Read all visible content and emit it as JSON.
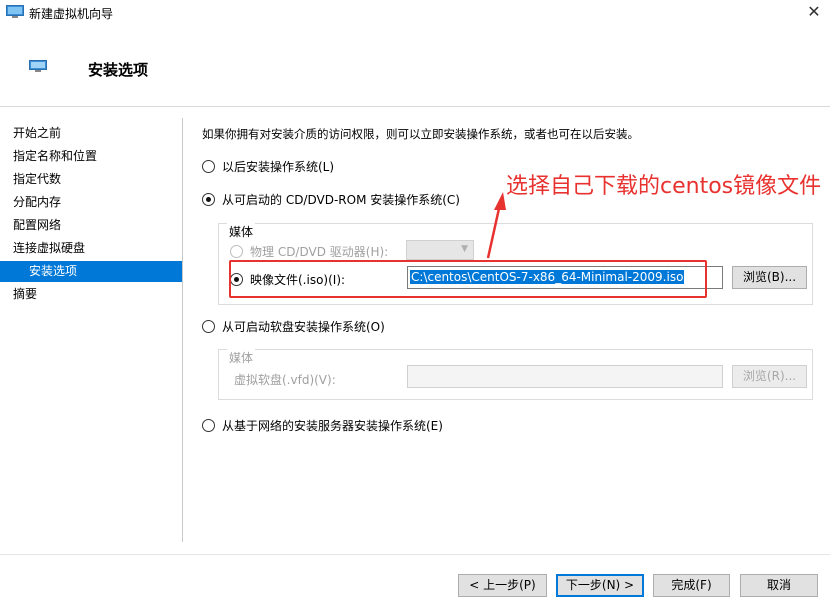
{
  "window": {
    "title": "新建虚拟机向导",
    "close_glyph": "✕"
  },
  "header": {
    "title": "安装选项"
  },
  "sidebar": {
    "items": [
      {
        "label": "开始之前"
      },
      {
        "label": "指定名称和位置"
      },
      {
        "label": "指定代数"
      },
      {
        "label": "分配内存"
      },
      {
        "label": "配置网络"
      },
      {
        "label": "连接虚拟硬盘"
      },
      {
        "label": "安装选项"
      },
      {
        "label": "摘要"
      }
    ],
    "active_index": 6
  },
  "main": {
    "description": "如果你拥有对安装介质的访问权限，则可以立即安装操作系统，或者也可在以后安装。",
    "option_later": "以后安装操作系统(L)",
    "option_cd": "从可启动的 CD/DVD-ROM 安装操作系统(C)",
    "cd_group": {
      "legend": "媒体",
      "physical_label": "物理 CD/DVD 驱动器(H):",
      "iso_label": "映像文件(.iso)(I):",
      "iso_value": "C:\\centos\\CentOS-7-x86_64-Minimal-2009.iso",
      "browse_label": "浏览(B)..."
    },
    "option_floppy": "从可启动软盘安装操作系统(O)",
    "floppy_group": {
      "legend": "媒体",
      "vfd_label": "虚拟软盘(.vfd)(V):",
      "vfd_value": "",
      "browse_label": "浏览(R)..."
    },
    "option_network": "从基于网络的安装服务器安装操作系统(E)",
    "selected_option": "cd",
    "iso_selected": true
  },
  "annotation": {
    "text": "选择自己下载的centos镜像文件",
    "color": "#e8322f"
  },
  "footer": {
    "prev_label": "< 上一步(P)",
    "next_label": "下一步(N) >",
    "finish_label": "完成(F)",
    "cancel_label": "取消"
  },
  "colors": {
    "accent": "#0078d7",
    "annotation": "#e8322f"
  }
}
